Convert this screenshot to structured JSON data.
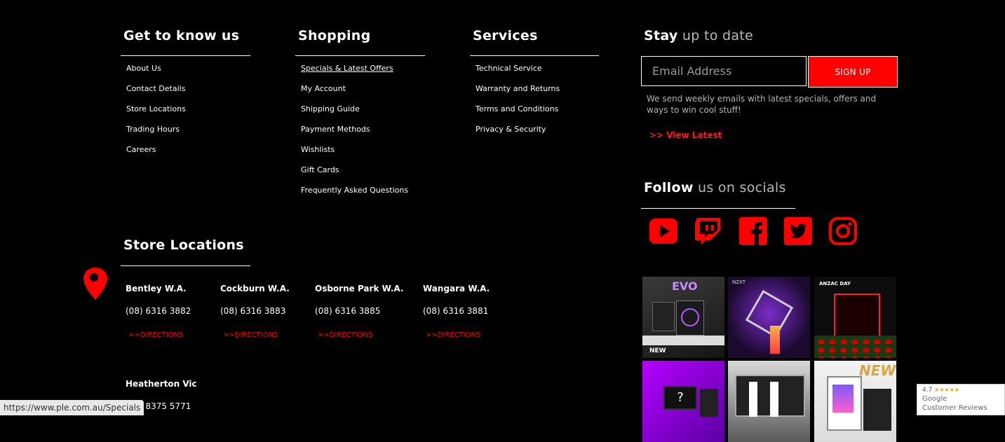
{
  "columns": [
    {
      "title": "Get to know us",
      "links": [
        "About Us",
        "Contact Details",
        "Store Locations",
        "Trading Hours",
        "Careers"
      ]
    },
    {
      "title": "Shopping",
      "links": [
        "Specials & Latest Offers",
        "My Account",
        "Shipping Guide",
        "Payment Methods",
        "Wishlists",
        "Gift Cards",
        "Frequently Asked Questions"
      ]
    },
    {
      "title": "Services",
      "links": [
        "Technical Service",
        "Warranty and Returns",
        "Terms and Conditions",
        "Privacy & Security"
      ]
    }
  ],
  "newsletter": {
    "title_bold": "Stay",
    "title_rest": " up to date",
    "email_placeholder": "Email Address",
    "signup_label": "SIGN UP",
    "note": "We send weekly emails with latest specials, offers and ways to win cool stuff!",
    "view_latest": ">> View Latest"
  },
  "socials": {
    "title_bold": "Follow",
    "title_rest": " us on socials",
    "icons": [
      "youtube-icon",
      "twitch-icon",
      "facebook-icon",
      "twitter-icon",
      "instagram-icon"
    ],
    "color": "#ff0000"
  },
  "stores": {
    "title": "Store Locations",
    "items": [
      {
        "name": "Bentley W.A.",
        "phone": "(08) 6316 3882",
        "directions": ">>DIRECTIONS"
      },
      {
        "name": "Cockburn W.A.",
        "phone": "(08) 6316 3883",
        "directions": ">>DIRECTIONS"
      },
      {
        "name": "Osborne Park W.A.",
        "phone": "(08) 6316 3885",
        "directions": ">>DIRECTIONS"
      },
      {
        "name": "Wangara W.A.",
        "phone": "(08) 6316 3881",
        "directions": ">>DIRECTIONS"
      },
      {
        "name": "Heatherton Vic",
        "phone": "(03) 8375 5771"
      }
    ]
  },
  "instagram": {
    "tiles": [
      {
        "label": "EVO",
        "sub": "NEW"
      },
      {
        "label": "NZXT"
      },
      {
        "label": "ANZAC DAY"
      },
      {
        "label": "?"
      },
      {
        "label": ""
      },
      {
        "label": "NEW"
      }
    ]
  },
  "status_url": "https://www.ple.com.au/Specials",
  "google_reviews": {
    "rating": "4.7",
    "stars": "★★★★★",
    "line1": "Google",
    "line2": "Customer Reviews"
  },
  "accent": "#ff0000"
}
